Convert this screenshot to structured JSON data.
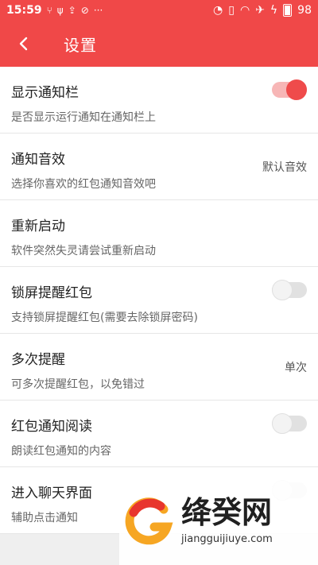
{
  "statusbar": {
    "time": "15:59",
    "battery": "98"
  },
  "appbar": {
    "title": "设置"
  },
  "settings": [
    {
      "title": "显示通知栏",
      "subtitle": "是否显示运行通知在通知栏上",
      "toggle": true
    },
    {
      "title": "通知音效",
      "subtitle": "选择你喜欢的红包通知音效吧",
      "value": "默认音效"
    },
    {
      "title": "重新启动",
      "subtitle": "软件突然失灵请尝试重新启动"
    },
    {
      "title": "锁屏提醒红包",
      "subtitle": "支持锁屏提醒红包(需要去除锁屏密码)",
      "toggle": false
    },
    {
      "title": "多次提醒",
      "subtitle": "可多次提醒红包，以免错过",
      "value": "单次"
    },
    {
      "title": "红包通知阅读",
      "subtitle": "朗读红包通知的内容",
      "toggle": false
    },
    {
      "title": "进入聊天界面",
      "subtitle": "辅助点击通知",
      "toggle": false
    }
  ],
  "watermark": {
    "name": "绛癸网",
    "url": "jiangguijiuye.com"
  },
  "colors": {
    "accent": "#f04848",
    "toggle_on": "#ef4b4b",
    "toggle_off": "#e1e1e1"
  }
}
